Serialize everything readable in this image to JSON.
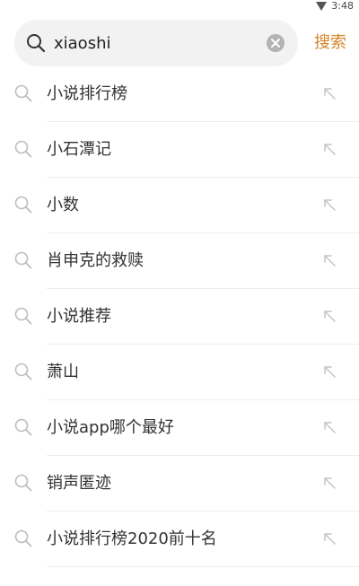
{
  "status_bar": {
    "time": "3:48",
    "signal_icon": "signal-triangle-icon"
  },
  "search": {
    "value": "xiaoshi",
    "search_icon": "search-icon",
    "clear_icon": "clear-icon",
    "button_label": "搜索",
    "accent_color": "#d4852a"
  },
  "suggestions": [
    {
      "label": "小说排行榜"
    },
    {
      "label": "小石潭记"
    },
    {
      "label": "小数"
    },
    {
      "label": "肖申克的救赎"
    },
    {
      "label": "小说推荐"
    },
    {
      "label": "萧山"
    },
    {
      "label": "小说app哪个最好"
    },
    {
      "label": "销声匿迹"
    },
    {
      "label": "小说排行榜2020前十名"
    }
  ]
}
